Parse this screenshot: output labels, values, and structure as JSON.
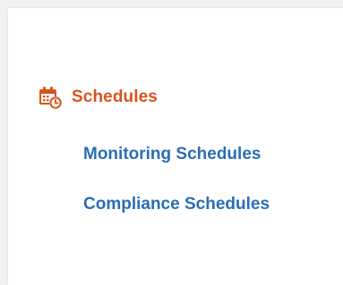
{
  "colors": {
    "accent": "#d9531e",
    "link": "#2a6db5",
    "panel_bg": "#ffffff",
    "page_bg": "#f2f2f2"
  },
  "section": {
    "icon": "calendar-clock-icon",
    "title": "Schedules"
  },
  "links": [
    {
      "label": "Monitoring Schedules"
    },
    {
      "label": "Compliance Schedules"
    }
  ]
}
